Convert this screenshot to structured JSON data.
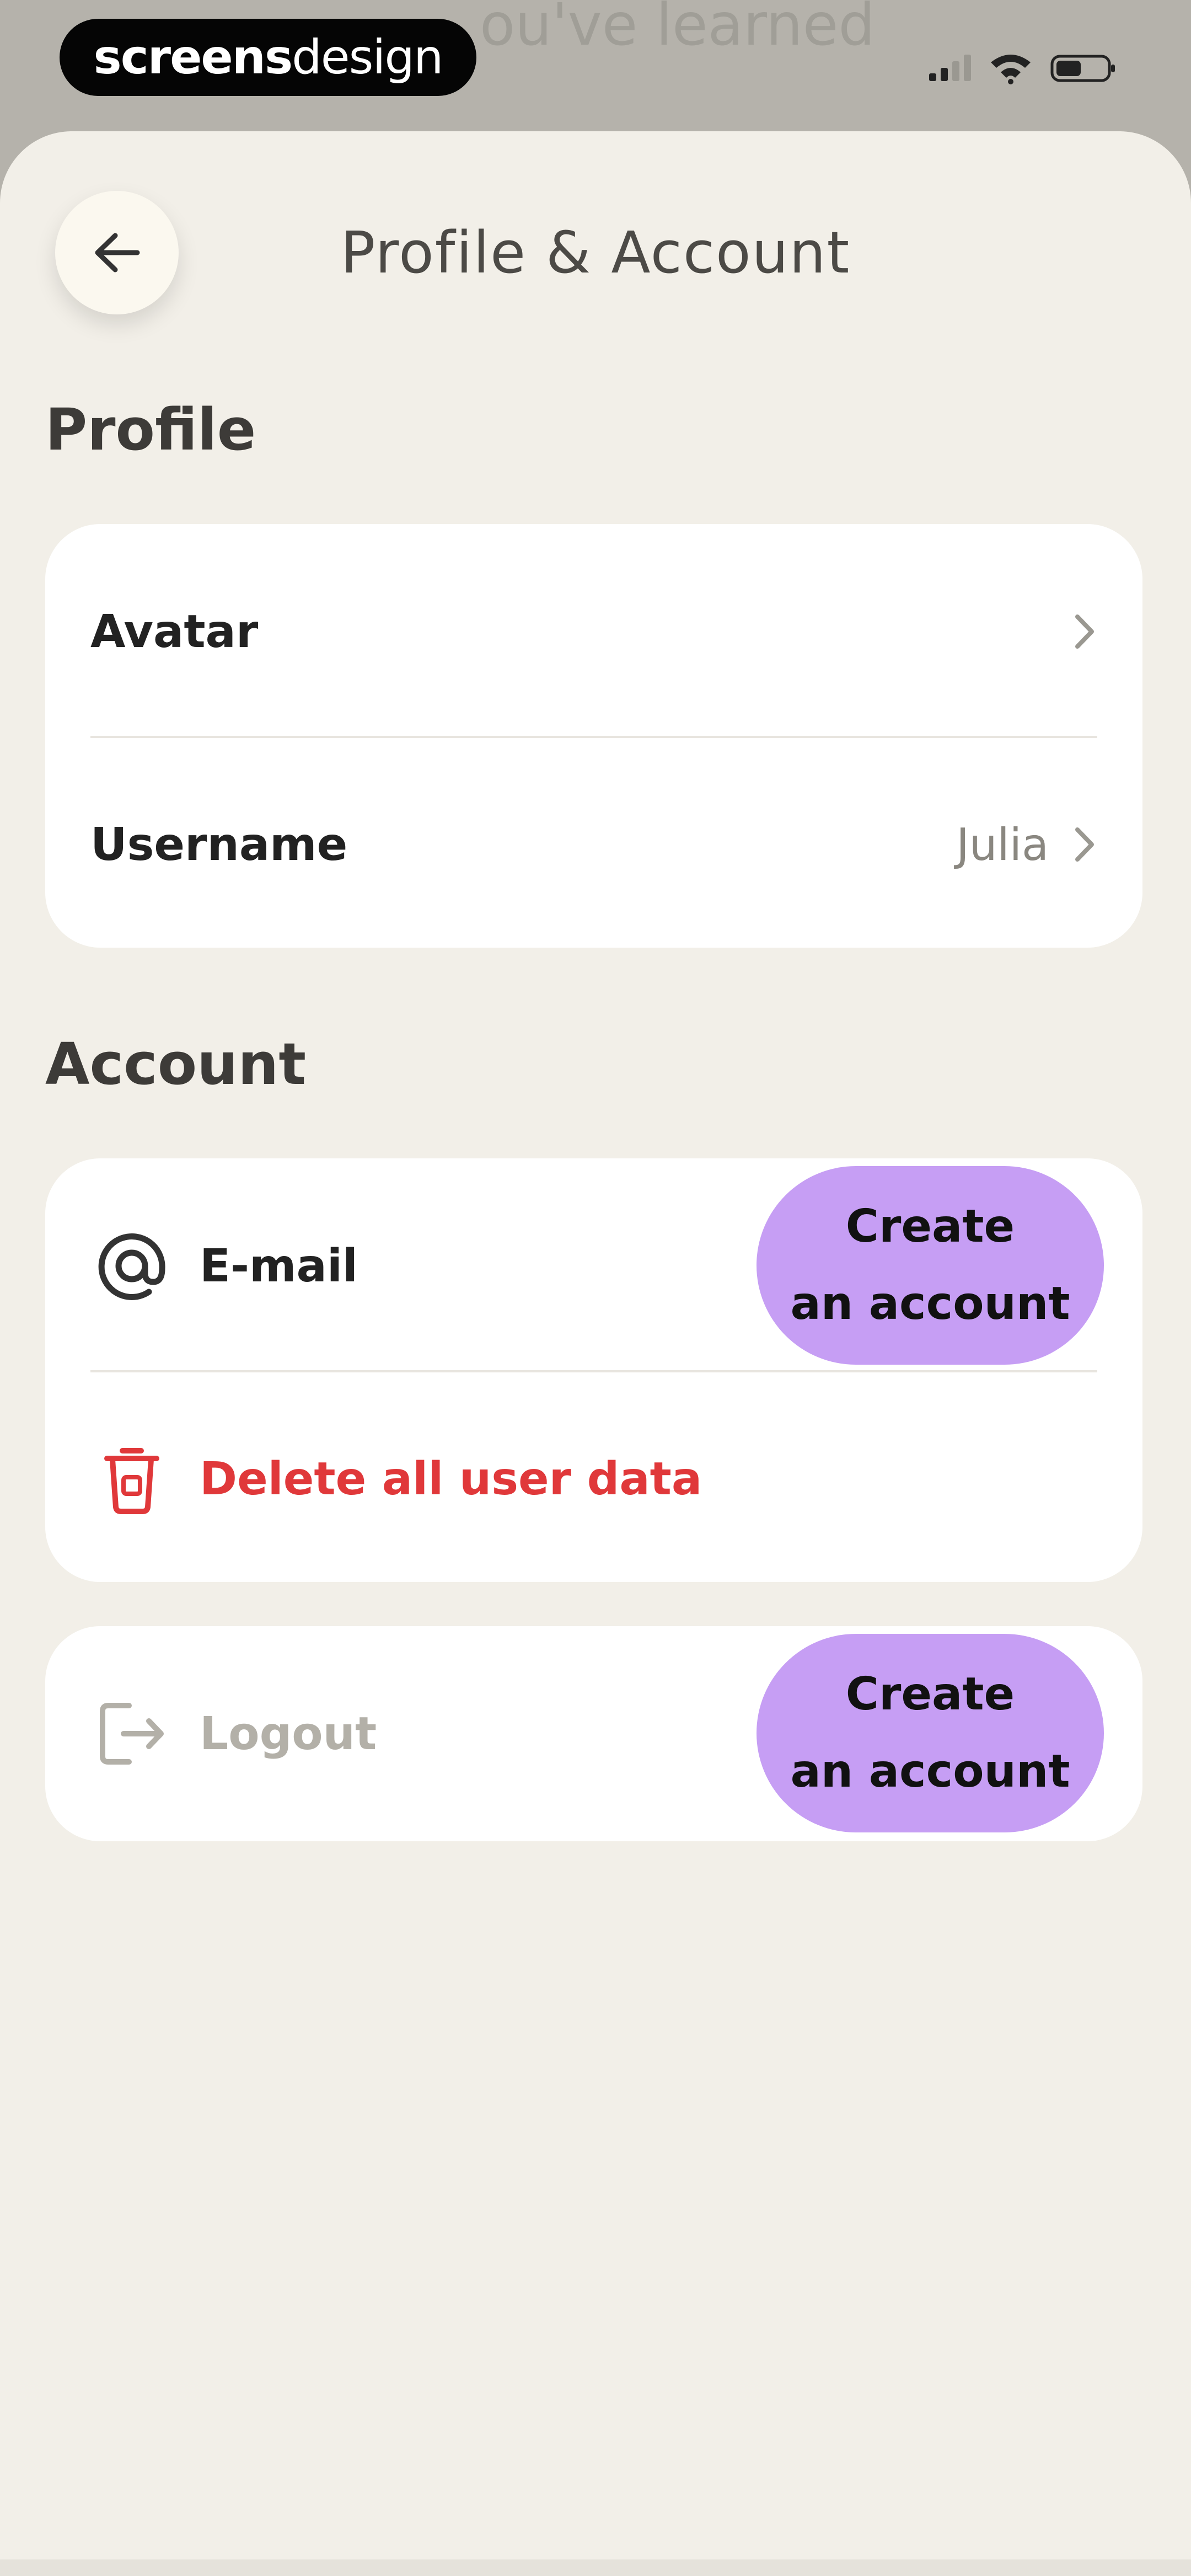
{
  "background_text": "ou've learned",
  "status_bar": {
    "brand_bold": "screens",
    "brand_light": "design"
  },
  "header": {
    "title": "Profile & Account",
    "back_icon": "arrow-left-icon"
  },
  "profile": {
    "section_title": "Profile",
    "avatar_label": "Avatar",
    "username_label": "Username",
    "username_value": "Julia"
  },
  "account": {
    "section_title": "Account",
    "email_label": "E-mail",
    "email_icon": "at-sign-icon",
    "email_cta_line1": "Create",
    "email_cta_line2": "an account",
    "delete_label": "Delete all user data",
    "delete_icon": "trash-icon",
    "delete_color": "#e0383a"
  },
  "logout": {
    "label": "Logout",
    "icon": "logout-icon",
    "cta_line1": "Create",
    "cta_line2": "an account"
  },
  "colors": {
    "accent": "#c69ef4",
    "sheet_background": "#f2efe8",
    "card_background": "#ffffff",
    "danger": "#e0383a"
  }
}
